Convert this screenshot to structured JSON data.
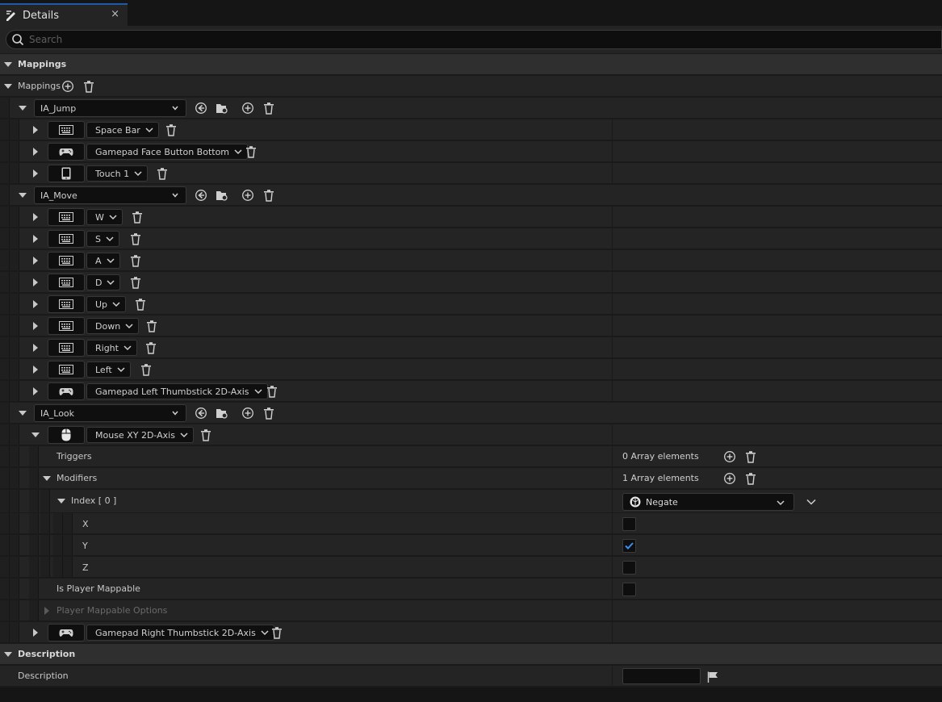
{
  "tab": {
    "title": "Details",
    "close": "×"
  },
  "search": {
    "placeholder": "Search"
  },
  "categories": {
    "mappings": "Mappings",
    "description": "Description"
  },
  "mappings_array_label": "Mappings",
  "actions": [
    {
      "name": "IA_Jump",
      "keys": [
        {
          "device": "keyboard-icon",
          "key": "Space Bar"
        },
        {
          "device": "gamepad-icon",
          "key": "Gamepad Face Button Bottom"
        },
        {
          "device": "touch-icon",
          "key": "Touch 1"
        }
      ]
    },
    {
      "name": "IA_Move",
      "keys": [
        {
          "device": "keyboard-icon",
          "key": "W"
        },
        {
          "device": "keyboard-icon",
          "key": "S"
        },
        {
          "device": "keyboard-icon",
          "key": "A"
        },
        {
          "device": "keyboard-icon",
          "key": "D"
        },
        {
          "device": "keyboard-icon",
          "key": "Up"
        },
        {
          "device": "keyboard-icon",
          "key": "Down"
        },
        {
          "device": "keyboard-icon",
          "key": "Right"
        },
        {
          "device": "keyboard-icon",
          "key": "Left"
        },
        {
          "device": "gamepad-icon",
          "key": "Gamepad Left Thumbstick 2D-Axis"
        }
      ]
    },
    {
      "name": "IA_Look",
      "keys": [
        {
          "device": "mouse-icon",
          "key": "Mouse XY 2D-Axis"
        },
        {
          "device": "gamepad-icon",
          "key": "Gamepad Right Thumbstick 2D-Axis"
        }
      ]
    }
  ],
  "look_details": {
    "triggers_label": "Triggers",
    "triggers_count": "0 Array elements",
    "modifiers_label": "Modifiers",
    "modifiers_count": "1 Array elements",
    "index_label": "Index [ 0 ]",
    "modifier_value": "Negate",
    "x_label": "X",
    "x_checked": false,
    "y_label": "Y",
    "y_checked": true,
    "z_label": "Z",
    "z_checked": false,
    "player_mappable_label": "Is Player Mappable",
    "player_mappable_checked": false,
    "player_mappable_options_label": "Player Mappable Options"
  },
  "description_field": {
    "label": "Description",
    "value": ""
  },
  "colors": {
    "accent": "#1e5aa8",
    "check": "#3b8ff0",
    "panel": "#242424",
    "header": "#2f2f2f"
  }
}
